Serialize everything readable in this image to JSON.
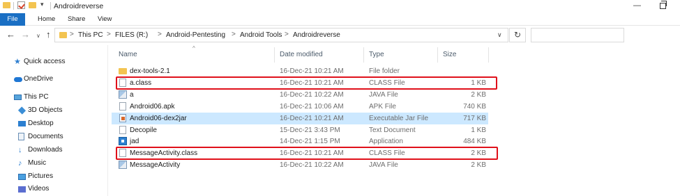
{
  "window": {
    "title": "Androidreverse"
  },
  "ribbon": {
    "tabs": [
      "File",
      "Home",
      "Share",
      "View"
    ]
  },
  "address": {
    "crumbs": [
      "This PC",
      "FILES (R:)",
      "Android-Pentesting",
      "Android Tools",
      "Androidreverse"
    ],
    "separator": ">"
  },
  "nav_buttons": {
    "back": "←",
    "forward": "→",
    "recent": "∨",
    "up": "↑",
    "refresh": "↻",
    "dropdown": "∨"
  },
  "navpane": {
    "items": [
      {
        "label": "Quick access",
        "icon": "star-icon"
      },
      {
        "label": "OneDrive",
        "icon": "cloud-icon"
      },
      {
        "label": "This PC",
        "icon": "computer-icon"
      },
      {
        "label": "3D Objects",
        "icon": "cube-icon"
      },
      {
        "label": "Desktop",
        "icon": "desktop-icon"
      },
      {
        "label": "Documents",
        "icon": "document-icon"
      },
      {
        "label": "Downloads",
        "icon": "download-icon"
      },
      {
        "label": "Music",
        "icon": "music-icon"
      },
      {
        "label": "Pictures",
        "icon": "pictures-icon"
      },
      {
        "label": "Videos",
        "icon": "video-icon"
      }
    ]
  },
  "columns": {
    "name": "Name",
    "date": "Date modified",
    "type": "Type",
    "size": "Size"
  },
  "files": [
    {
      "name": "dex-tools-2.1",
      "date": "16-Dec-21 10:21 AM",
      "type": "File folder",
      "size": "",
      "icon": "folder-icon"
    },
    {
      "name": "a.class",
      "date": "16-Dec-21 10:21 AM",
      "type": "CLASS File",
      "size": "1 KB",
      "icon": "file-icon"
    },
    {
      "name": "a",
      "date": "16-Dec-21 10:22 AM",
      "type": "JAVA File",
      "size": "2 KB",
      "icon": "java-file-icon"
    },
    {
      "name": "Android06.apk",
      "date": "16-Dec-21 10:06 AM",
      "type": "APK File",
      "size": "740 KB",
      "icon": "file-icon"
    },
    {
      "name": "Android06-dex2jar",
      "date": "16-Dec-21 10:21 AM",
      "type": "Executable Jar File",
      "size": "717 KB",
      "icon": "jar-icon"
    },
    {
      "name": "Decopile",
      "date": "15-Dec-21 3:43 PM",
      "type": "Text Document",
      "size": "1 KB",
      "icon": "text-file-icon"
    },
    {
      "name": "jad",
      "date": "14-Dec-21 1:15 PM",
      "type": "Application",
      "size": "484 KB",
      "icon": "application-icon"
    },
    {
      "name": "MessageActivity.class",
      "date": "16-Dec-21 10:21 AM",
      "type": "CLASS File",
      "size": "2 KB",
      "icon": "file-icon"
    },
    {
      "name": "MessageActivity",
      "date": "16-Dec-21 10:22 AM",
      "type": "JAVA File",
      "size": "2 KB",
      "icon": "java-file-icon"
    }
  ],
  "selected_file": "Android06-dex2jar",
  "highlighted_files": [
    "a.class",
    "MessageActivity.class"
  ],
  "colors": {
    "selection": "#cce8ff",
    "highlight_box": "#e0101a",
    "file_tab": "#1a6fc4"
  }
}
